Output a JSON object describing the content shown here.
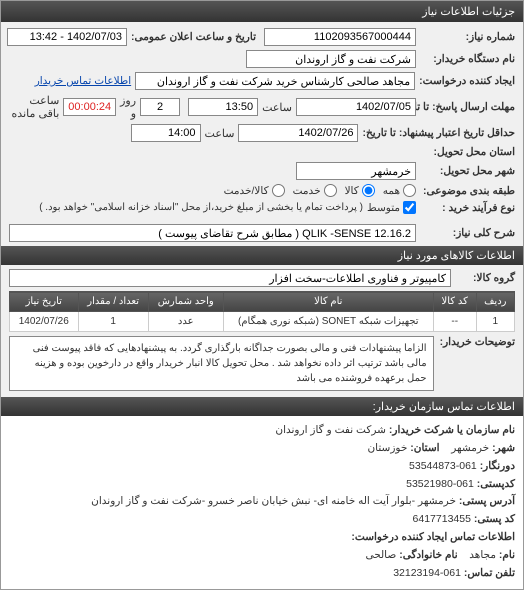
{
  "titlebar": "جزئیات اطلاعات نیاز",
  "fields": {
    "req_no_label": "شماره نیاز:",
    "req_no": "1102093567000444",
    "announce_label": "تاریخ و ساعت اعلان عمومی:",
    "announce": "1402/07/03 - 13:42",
    "device_label": "نام دستگاه خریدار:",
    "device": "شرکت نفت و گاز اروندان",
    "creator_label": "ایجاد کننده درخواست:",
    "creator": "مجاهد صالحی کارشناس خرید شرکت نفت و گاز اروندان",
    "contact_link": "اطلاعات تماس خریدار",
    "deadline_label": "مهلت ارسال پاسخ: تا تاریخ:",
    "deadline_date": "1402/07/05",
    "time_label": "ساعت",
    "deadline_time": "13:50",
    "days_unit": "روز و",
    "days": "2",
    "remain_label": "ساعت باقی مانده",
    "remain_time": "00:00:24",
    "validity_label": "حداقل تاریخ اعتبار پیشنهاد: تا تاریخ:",
    "validity_date": "1402/07/26",
    "validity_time": "14:00",
    "province_label": "استان محل تحویل:",
    "city_label": "شهر محل تحویل:",
    "city": "خرمشهر",
    "category_label": "طبقه بندی موضوعی:",
    "cat_all": "همه",
    "cat_goods": "کالا",
    "cat_service": "خدمت",
    "cat_goods_service": "کالا/خدمت",
    "process_label": "نوع فرآیند خرید :",
    "process_mid": "متوسط",
    "process_note": "( پرداخت تمام یا بخشی از مبلغ خرید،از محل \"اسناد خزانه اسلامی\" خواهد بود. )",
    "subject_label": "شرح کلی نیاز:",
    "subject": "QLIK -SENSE 12.16.2 ( مطابق شرح تقاضای پیوست )"
  },
  "goods_section": "اطلاعات کالاهای مورد نیاز",
  "goods_group_label": "گروه کالا:",
  "goods_group": "کامپیوتر و فناوری اطلاعات-سخت افزار",
  "table": {
    "headers": [
      "ردیف",
      "کد کالا",
      "نام کالا",
      "واحد شمارش",
      "تعداد / مقدار",
      "تاریخ نیاز"
    ],
    "row": [
      "1",
      "--",
      "تجهیزات شبکه SONET (شبکه نوری همگام)",
      "عدد",
      "1",
      "1402/07/26"
    ]
  },
  "notes_label": "توضیحات خریدار:",
  "notes": "الزاما پیشنهادات فنی و مالی بصورت جداگانه بارگذاری گردد. به پیشنهادهایی که فاقد پیوست فنی مالی باشد ترتیب اثر داده نخواهد شد . محل تحویل کالا انبار خریدار واقع در دارخوین بوده و هزینه حمل برعهده فروشنده می باشد",
  "footer": {
    "title": "اطلاعات تماس سازمان خریدار:",
    "org_label": "نام سازمان یا شرکت خریدار:",
    "org": "شرکت نفت و گاز اروندان",
    "city_label": "شهر:",
    "city": "خرمشهر",
    "province_label": "استان:",
    "province": "خوزستان",
    "fax_label": "دورنگار:",
    "fax": "061-53544873",
    "postal_label": "کدپستی:",
    "postal": "061-53521980",
    "address_label": "آدرس پستی:",
    "address": "خرمشهر -بلوار آیت اله خامنه ای- نبش خیابان ناصر خسرو -شرکت نفت و گاز اروندان",
    "postcode_label": "کد پستی:",
    "postcode": "6417713455",
    "creator_contact_title": "اطلاعات تماس ایجاد کننده درخواست:",
    "name_label": "نام:",
    "name": "مجاهد",
    "family_label": "نام خانوادگی:",
    "family": "صالحی",
    "phone_label": "تلفن تماس:",
    "phone": "061-32123194"
  }
}
